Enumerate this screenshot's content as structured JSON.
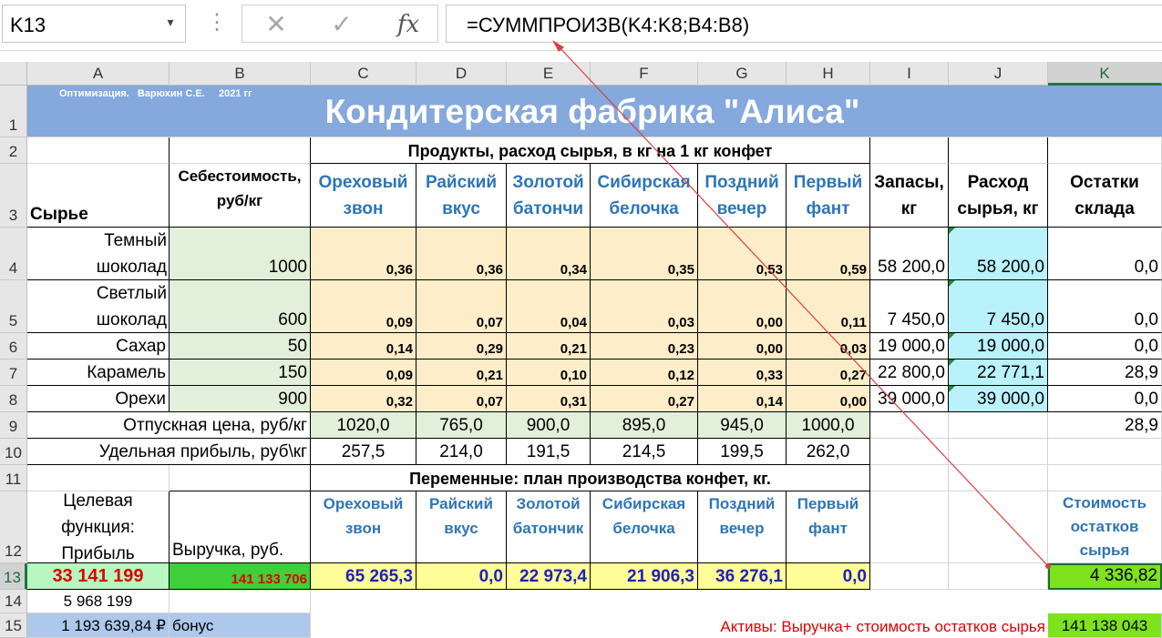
{
  "toolbar": {
    "name_box": "K13",
    "name_box_arrow": "▾",
    "dots": "⋮",
    "cancel_glyph": "✕",
    "enter_glyph": "✓",
    "fx_glyph": "fx",
    "formula": "=СУММПРОИЗВ(K4:K8;B4:B8)"
  },
  "columns": [
    "A",
    "B",
    "C",
    "D",
    "E",
    "F",
    "G",
    "H",
    "I",
    "J",
    "K"
  ],
  "rows": [
    "1",
    "2",
    "3",
    "4",
    "5",
    "6",
    "7",
    "8",
    "9",
    "10",
    "11",
    "12",
    "13",
    "14",
    "15"
  ],
  "sheet": {
    "author_note": "Оптимизация.   Варюхин С.Е.     2021 гг",
    "title": "Кондитерская фабрика \"Алиса\"",
    "header_products": "Продукты, расход сырья, в кг на 1 кг конфет",
    "header_raw": "Сырье",
    "header_cost": "Себестоимость, руб/кг",
    "products": [
      "Ореховый звон",
      "Райский вкус",
      "Золотой батончи",
      "Сибирская белочка",
      "Поздний вечер",
      "Первый фант"
    ],
    "header_stock": "Запасы, кг",
    "header_usage": "Расход сырья, кг",
    "header_remain": "Остатки склада",
    "materials": [
      {
        "name": "Темный шоколад",
        "cost": "1000",
        "norms": [
          "0,36",
          "0,36",
          "0,34",
          "0,35",
          "0,53",
          "0,59"
        ],
        "stock": "58 200,0",
        "usage": "58 200,0",
        "remain": "0,0"
      },
      {
        "name": "Светлый шоколад",
        "cost": "600",
        "norms": [
          "0,09",
          "0,07",
          "0,04",
          "0,03",
          "0,00",
          "0,11"
        ],
        "stock": "7 450,0",
        "usage": "7 450,0",
        "remain": "0,0"
      },
      {
        "name": "Сахар",
        "cost": "50",
        "norms": [
          "0,14",
          "0,29",
          "0,21",
          "0,23",
          "0,00",
          "0,03"
        ],
        "stock": "19 000,0",
        "usage": "19 000,0",
        "remain": "0,0"
      },
      {
        "name": "Карамель",
        "cost": "150",
        "norms": [
          "0,09",
          "0,21",
          "0,10",
          "0,12",
          "0,33",
          "0,27"
        ],
        "stock": "22 800,0",
        "usage": "22 771,1",
        "remain": "28,9"
      },
      {
        "name": "Орехи",
        "cost": "900",
        "norms": [
          "0,32",
          "0,07",
          "0,31",
          "0,27",
          "0,14",
          "0,00"
        ],
        "stock": "39 000,0",
        "usage": "39 000,0",
        "remain": "0,0"
      }
    ],
    "price_label": "Отпускная цена, руб/кг",
    "prices": [
      "1020,0",
      "765,0",
      "900,0",
      "895,0",
      "945,0",
      "1000,0"
    ],
    "price_remain": "28,9",
    "profit_label": "Удельная прибыль, руб\\кг",
    "profits": [
      "257,5",
      "214,0",
      "191,5",
      "214,5",
      "199,5",
      "262,0"
    ],
    "header_plan": "Переменные: план производства конфет, кг.",
    "target_label": "Целевая функция: Прибыль",
    "revenue_label": "Выручка, руб.",
    "products2": [
      "Ореховый звон",
      "Райский вкус",
      "Золотой батончик",
      "Сибирская белочка",
      "Поздний вечер",
      "Первый фант"
    ],
    "remain_cost_label": "Стоимость остатков сырья",
    "profit_value": "33 141 199",
    "revenue_value": "141 133 706",
    "plan": [
      "65 265,3",
      "0,0",
      "22 973,4",
      "21 906,3",
      "36 276,1",
      "0,0"
    ],
    "remain_cost_value": "4 336,82",
    "row14_value": "5 968 199",
    "row15_value": "1 193 639,84 ₽",
    "bonus_label": "бонус",
    "assets_label": "Активы: Выручка+ стоимость остатков сырья",
    "assets_value": "141 138 043"
  },
  "colors": {
    "title_fill": "#85a8dd",
    "norm_fill": "#fdedc9",
    "cost_fill": "#e2efda",
    "usage_fill": "#b9f2fb",
    "plan_fill": "#fffd98",
    "profit_fill": "#b9f7c0",
    "revenue_fill": "#3fcf3a",
    "selected_fill": "#7ee21c",
    "accent": "#217346",
    "arrow": "#e04040"
  }
}
